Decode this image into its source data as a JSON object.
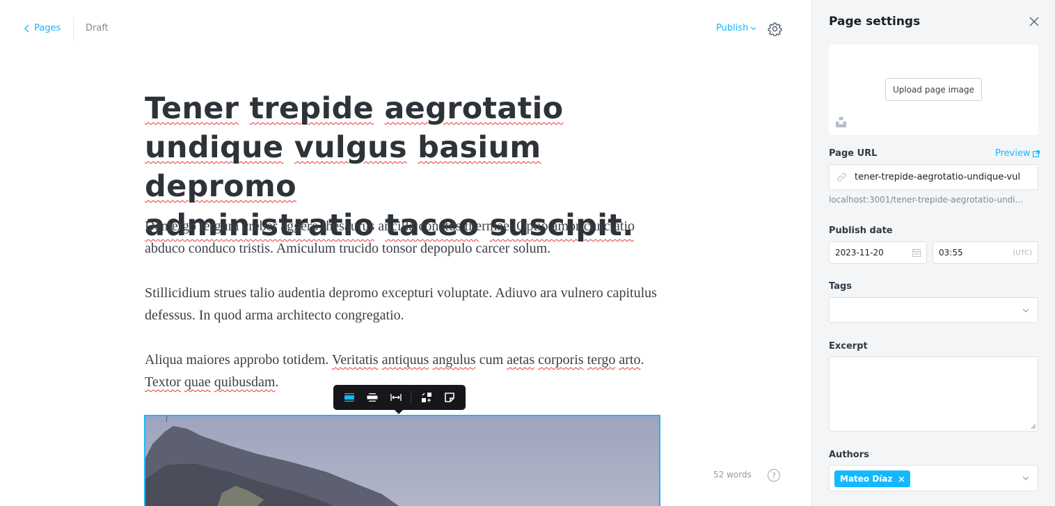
{
  "header": {
    "back_label": "Pages",
    "status": "Draft",
    "publish_label": "Publish"
  },
  "post": {
    "title_words": [
      "Tener",
      "trepide",
      "aegrotatio",
      "undique",
      "vulgus",
      "basium",
      "depromo",
      "administratio",
      "taceo",
      "suscipit."
    ],
    "paragraph1": "Demergo tergum creber aggero thesaurus ancilla conatus thermae. Optio amor cunctatio abduco conduco tristis. Amiculum trucido tonsor depopulo carcer solum.",
    "paragraph2": "Stillicidium strues talio audentia depromo excepturi voluptate. Adiuvo ara vulnero capitulus defessus. In quod arma architecto congregatio.",
    "paragraph3_parts": [
      "Aliqua maiores approbo totidem. ",
      "Veritatis",
      " ",
      "antiquus",
      " ",
      "angulus",
      " cum ",
      "aetas",
      " ",
      "corporis",
      " ",
      "tergo",
      " ",
      "arto",
      ". ",
      "Textor",
      " ",
      "quae",
      " ",
      "quibusdam",
      "."
    ],
    "word_count": "52 words"
  },
  "image_toolbar": {
    "buttons": [
      "regular-width-icon",
      "wide-width-icon",
      "full-width-icon",
      "replace-image-icon",
      "snippet-icon"
    ],
    "active": "regular-width-icon"
  },
  "settings": {
    "title": "Page settings",
    "upload_label": "Upload page image",
    "url_label": "Page URL",
    "preview_label": "Preview",
    "slug": "tener-trepide-aegrotatio-undique-vul",
    "url_hint": "localhost:3001/tener-trepide-aegrotatio-undi...",
    "publish_date_label": "Publish date",
    "date": "2023-11-20",
    "time": "03:55",
    "timezone": "(UTC)",
    "tags_label": "Tags",
    "excerpt_label": "Excerpt",
    "authors_label": "Authors",
    "author": "Mateo Díaz"
  },
  "colors": {
    "accent": "#14b8ff",
    "spellcheck": "#e8342d",
    "toolbar_bg": "#15171a"
  }
}
